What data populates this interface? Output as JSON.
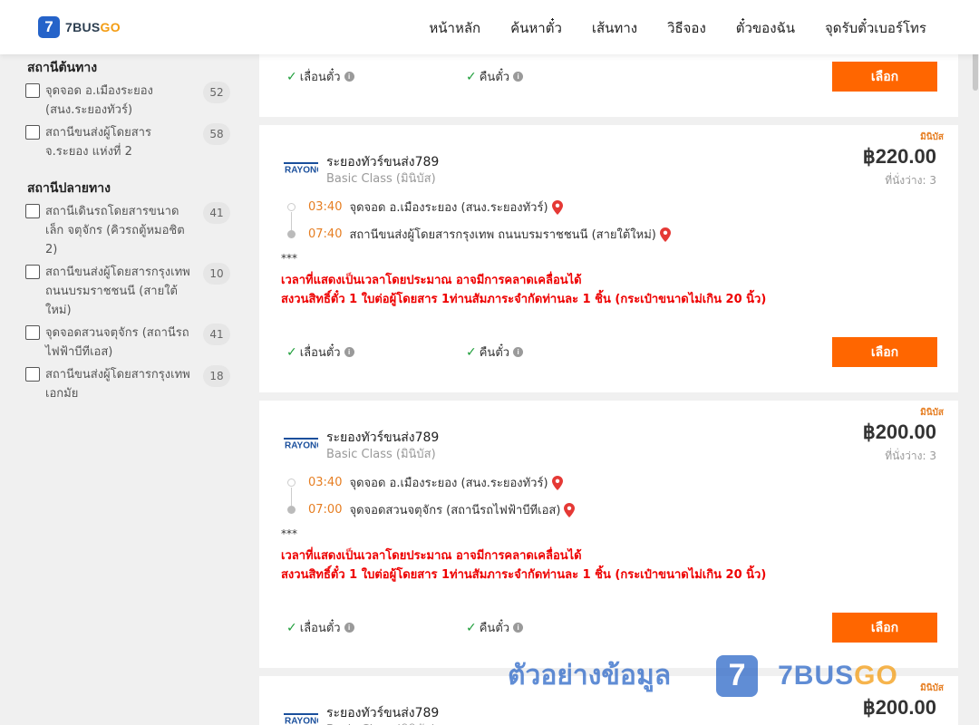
{
  "brand": {
    "logo_char": "7",
    "name_main": "7BUS",
    "name_accent": "GO"
  },
  "nav": [
    {
      "label": "หน้าหลัก"
    },
    {
      "label": "ค้นหาตั๋ว"
    },
    {
      "label": "เส้นทาง"
    },
    {
      "label": "วิธีจอง"
    },
    {
      "label": "ตั๋วของฉัน"
    },
    {
      "label": "จุดรับตั๋วเบอร์โทร"
    }
  ],
  "sidebar": {
    "origin_title": "สถานีต้นทาง",
    "origin_items": [
      {
        "label": "จุดจอด อ.เมืองระยอง (สนง.ระยองทัวร์)",
        "count": "52"
      },
      {
        "label": "สถานีขนส่งผู้โดยสาร จ.ระยอง แห่งที่ 2",
        "count": "58"
      }
    ],
    "dest_title": "สถานีปลายทาง",
    "dest_items": [
      {
        "label": "สถานีเดินรถโดยสารขนาดเล็ก จตุจักร (คิวรถตู้หมอชิต 2)",
        "count": "41"
      },
      {
        "label": "สถานีขนส่งผู้โดยสารกรุงเทพ ถนนบรมราชชนนี (สายใต้ใหม่)",
        "count": "10"
      },
      {
        "label": "จุดจอดสวนจตุจักร (สถานีรถไฟฟ้าบีทีเอส)",
        "count": "41"
      },
      {
        "label": "สถานีขนส่งผู้โดยสารกรุงเทพ เอกมัย",
        "count": "18"
      }
    ]
  },
  "features": {
    "change": "เลื่อนตั๋ว",
    "refund": "คืนตั๋ว",
    "info": "i"
  },
  "select_label": "เลือก",
  "cards": [
    {
      "tag": "มินิบัส",
      "operator": "ระยองทัวร์ขนส่ง789",
      "bus_class": "Basic Class (มินิบัส)",
      "price": "฿220.00",
      "seats": "ที่นั่งว่าง: 3",
      "depart_time": "03:40",
      "depart_stop": "จุดจอด อ.เมืองระยอง (สนง.ระยองทัวร์)",
      "arrive_time": "07:40",
      "arrive_stop": "สถานีขนส่งผู้โดยสารกรุงเทพ ถนนบรมราชชนนี (สายใต้ใหม่)",
      "stars": "***",
      "note1": "เวลาที่แสดงเป็นเวลาโดยประมาณ อาจมีการคลาดเคลื่อนได้",
      "note2": "สงวนสิทธิ์ตั๋ว 1 ใบต่อผู้โดยสาร 1ท่านสัมภาระจำกัดท่านละ 1 ชิ้น (กระเป๋าขนาดไม่เกิน 20 นิ้ว)"
    },
    {
      "tag": "มินิบัส",
      "operator": "ระยองทัวร์ขนส่ง789",
      "bus_class": "Basic Class (มินิบัส)",
      "price": "฿200.00",
      "seats": "ที่นั่งว่าง: 3",
      "depart_time": "03:40",
      "depart_stop": "จุดจอด อ.เมืองระยอง (สนง.ระยองทัวร์)",
      "arrive_time": "07:00",
      "arrive_stop": "จุดจอดสวนจตุจักร (สถานีรถไฟฟ้าบีทีเอส)",
      "stars": "***",
      "note1": "เวลาที่แสดงเป็นเวลาโดยประมาณ อาจมีการคลาดเคลื่อนได้",
      "note2": "สงวนสิทธิ์ตั๋ว 1 ใบต่อผู้โดยสาร 1ท่านสัมภาระจำกัดท่านละ 1 ชิ้น (กระเป๋าขนาดไม่เกิน 20 นิ้ว)"
    },
    {
      "tag": "มินิบัส",
      "operator": "ระยองทัวร์ขนส่ง789",
      "bus_class": "Basic Class (มินิบัส)",
      "price": "฿200.00"
    }
  ],
  "watermark": {
    "text": "ตัวอย่างข้อมูล",
    "mark": "7",
    "brand_main": "7BUS",
    "brand_accent": "GO"
  },
  "colors": {
    "accent": "#ff6600",
    "brand_blue": "#2563c9",
    "time": "#e67e22",
    "note": "#ee0000",
    "check": "#1e9e3a"
  }
}
